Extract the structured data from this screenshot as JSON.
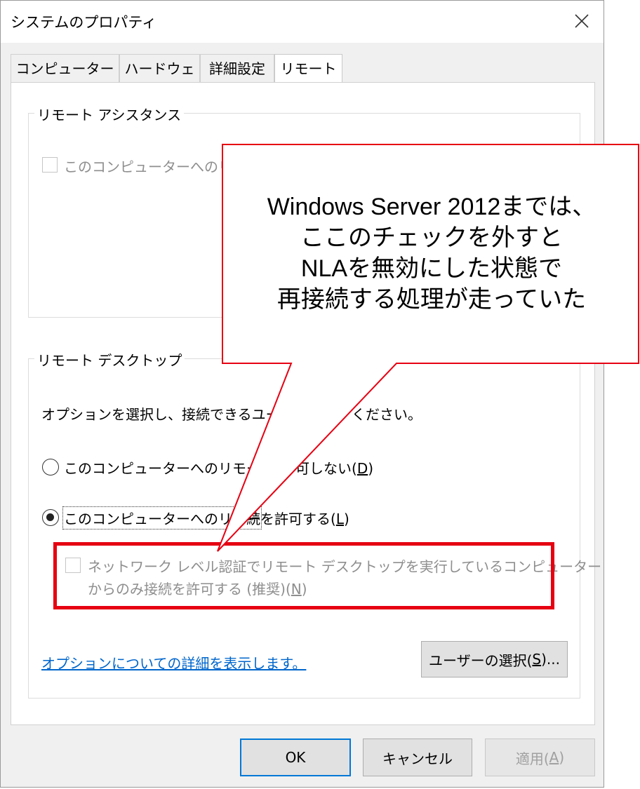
{
  "window": {
    "title": "システムのプロパティ",
    "close_icon": "close-icon"
  },
  "tabs": [
    {
      "label": "コンピューター名",
      "active": false
    },
    {
      "label": "ハードウェア",
      "active": false
    },
    {
      "label": "詳細設定",
      "active": false
    },
    {
      "label": "リモート",
      "active": true
    }
  ],
  "remote_assistance": {
    "title": "リモート アシスタンス",
    "checkbox_label": "このコンピューターへのリモー",
    "checked": false,
    "enabled": false
  },
  "remote_desktop": {
    "title": "リモート デスクトップ",
    "description_part1": "オプションを選択し、接続できるユーザ",
    "description_part2": "ください。",
    "radio_disallow_part1": "このコンピューターへのリモート接",
    "radio_disallow_part2": "可しない(",
    "radio_disallow_key": "D",
    "radio_allow_part1": "このコンピューターへのリモー",
    "radio_allow_part2": "続を許可する(",
    "radio_allow_key": "L",
    "selected": "allow",
    "nla_line1": "ネットワーク レベル認証でリモート デスクトップを実行しているコンピューター",
    "nla_line2": "からのみ接続を許可する (推奨)(",
    "nla_key": "N",
    "nla_checked": false,
    "nla_enabled": false,
    "help_link": "オプションについての詳細を表示します。",
    "select_users_label": "ユーザーの選択(",
    "select_users_key": "S",
    "select_users_suffix": ")..."
  },
  "buttons": {
    "ok": "OK",
    "cancel": "キャンセル",
    "apply": "適用(",
    "apply_key": "A",
    "apply_enabled": false
  },
  "callout": {
    "lines": [
      "Windows Server 2012までは、",
      "ここのチェックを外すと",
      "NLAを無効にした状態で",
      "再接続する処理が走っていた"
    ],
    "border_color": "#e60012"
  }
}
